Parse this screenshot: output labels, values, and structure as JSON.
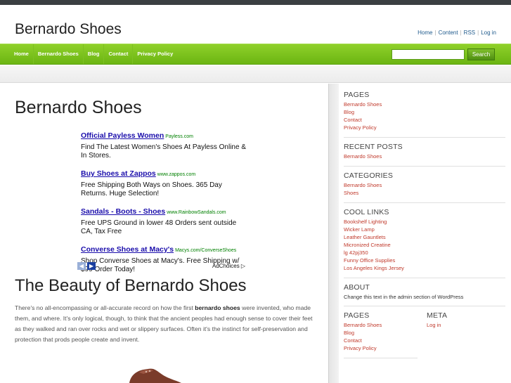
{
  "site": {
    "title": "Bernardo Shoes",
    "top_links": [
      "Home",
      "Content",
      "RSS",
      "Log in"
    ]
  },
  "nav": {
    "items": [
      "Home",
      "Bernardo Shoes",
      "Blog",
      "Contact",
      "Privacy Policy"
    ],
    "search_placeholder": "",
    "search_button": "Search"
  },
  "main": {
    "heading": "Bernardo Shoes",
    "ads": [
      {
        "title": "Official Payless Women",
        "url": "Payless.com",
        "text": "Find The Latest Women's Shoes At Payless Online & In Stores."
      },
      {
        "title": "Buy Shoes at Zappos",
        "url": "www.zappos.com",
        "text": "Free Shipping Both Ways on Shoes. 365 Day Returns. Huge Selection!"
      },
      {
        "title": "Sandals - Boots - Shoes",
        "url": "www.RainbowSandals.com",
        "text": "Free UPS Ground in lower 48 Orders sent outside CA, Tax Free"
      },
      {
        "title": "Converse Shoes at Macy's",
        "url": "Macys.com/ConverseShoes",
        "text": "Shop Converse Shoes at Macy's. Free Shipping w/ $99 Order Today!"
      }
    ],
    "adchoices": "AdChoices ▷",
    "subheading": "The Beauty of Bernardo Shoes",
    "article_before": "There's no all-encompassing or all-accurate record on how the first ",
    "article_bold": "bernardo shoes",
    "article_after": " were invented, who made them, and where.  It's only logical, though, to think that the ancient peoples  had enough sense to cover their feet as they walked and ran over rocks and wet  or slippery surfaces. Often it's the instinct for self-preservation and protection  that prods people create and invent."
  },
  "sidebar": {
    "pages": {
      "title": "PAGES",
      "links": [
        "Bernardo Shoes",
        "Blog",
        "Contact",
        "Privacy Policy"
      ]
    },
    "recent": {
      "title": "RECENT POSTS",
      "links": [
        "Bernardo Shoes"
      ]
    },
    "categories": {
      "title": "CATEGORIES",
      "links": [
        "Bernardo Shoes",
        "Shoes"
      ]
    },
    "cool": {
      "title": "COOL LINKS",
      "links": [
        "Bookshelf Lighting",
        "Wicker Lamp",
        "Leather Gauntlets",
        "Micronized Creatine",
        "lg 42pj350",
        "Funny Office Supplies",
        "Los Angeles Kings Jersey"
      ]
    },
    "about": {
      "title": "ABOUT",
      "text": "Change this text in the admin section of WordPress"
    },
    "pages2": {
      "title": "PAGES",
      "links": [
        "Bernardo Shoes",
        "Blog",
        "Contact",
        "Privacy Policy"
      ]
    },
    "meta": {
      "title": "META",
      "links": [
        "Log in"
      ]
    }
  },
  "colors": {
    "nav_green": "#7cc21f",
    "link_red": "#c0392b",
    "ad_blue": "#1a0dab",
    "ad_green": "#008000"
  }
}
